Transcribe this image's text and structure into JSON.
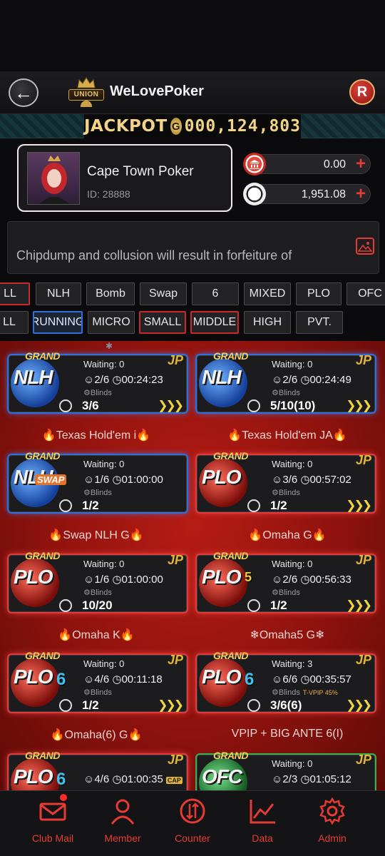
{
  "header": {
    "club_name": "WeLovePoker",
    "union_label": "UNION",
    "r_button": "R"
  },
  "jackpot": {
    "label": "JACKPOT",
    "coin": "G",
    "value": "000,124,803"
  },
  "profile": {
    "name": "Cape Town Poker",
    "id": "ID: 28888"
  },
  "balances": [
    {
      "icon": "bank-icon",
      "amount": "0.00",
      "plus": "+"
    },
    {
      "icon": "chip-icon",
      "amount": "1,951.08",
      "plus": "+"
    }
  ],
  "notice": {
    "text": "Chipdump and collusion will result in forfeiture of"
  },
  "game_filters": [
    "LL",
    "NLH",
    "Bomb",
    "Swap",
    "6",
    "MIXED",
    "PLO",
    "OFC"
  ],
  "stake_filters": [
    "LL",
    "RUNNING",
    "MICRO",
    "SMALL",
    "MIDDLE",
    "HIGH",
    "PVT."
  ],
  "tables": [
    {
      "logo": "NLH",
      "grand": "GRAND",
      "waiting": "Waiting: 0",
      "players": "2/6",
      "time": "00:24:23",
      "blinds": "Blinds",
      "stake": "3/6",
      "title": "Texas Hold'em i",
      "jp": "JP"
    },
    {
      "logo": "NLH",
      "grand": "GRAND",
      "waiting": "Waiting: 0",
      "players": "2/6",
      "time": "00:24:49",
      "blinds": "Blinds",
      "stake": "5/10",
      "stake_extra": "(10)",
      "title": "Texas Hold'em JA",
      "jp": "JP"
    },
    {
      "logo": "NLH",
      "grand": "GRAND",
      "swap": "SWAP",
      "waiting": "Waiting: 0",
      "players": "1/6",
      "time": "01:00:00",
      "blinds": "Blinds",
      "stake": "1/2",
      "title": "Swap NLH  G",
      "jp": ""
    },
    {
      "logo": "PLO",
      "grand": "GRAND",
      "waiting": "Waiting: 0",
      "players": "3/6",
      "time": "00:57:02",
      "blinds": "Blinds",
      "stake": "1/2",
      "title": "Omaha G",
      "jp": "JP"
    },
    {
      "logo": "PLO",
      "grand": "GRAND",
      "waiting": "Waiting: 0",
      "players": "1/6",
      "time": "01:00:00",
      "blinds": "Blinds",
      "stake": "10/20",
      "title": "Omaha K",
      "jp": "JP"
    },
    {
      "logo": "PLO",
      "grand": "GRAND",
      "sub": "5",
      "waiting": "Waiting: 0",
      "players": "2/6",
      "time": "00:56:33",
      "blinds": "Blinds",
      "stake": "1/2",
      "title": "Omaha5 G",
      "jp": "JP"
    },
    {
      "logo": "PLO",
      "grand": "GRAND",
      "sub": "6",
      "waiting": "Waiting: 0",
      "players": "4/6",
      "time": "00:11:18",
      "blinds": "Blinds",
      "stake": "1/2",
      "title": "Omaha(6)  G",
      "jp": "JP"
    },
    {
      "logo": "PLO",
      "grand": "GRAND",
      "sub": "6",
      "waiting": "Waiting: 3",
      "players": "6/6",
      "time": "00:35:57",
      "blinds": "Blinds",
      "vpip": "T-VPIP 45%",
      "stake": "3/6",
      "stake_extra": "(6)",
      "title": "VPIP + BIG ANTE 6(I)",
      "jp": "JP"
    },
    {
      "logo": "PLO",
      "grand": "GRAND",
      "sub": "6",
      "waiting": "",
      "players": "4/6",
      "time": "01:00:35",
      "cap": "CAP",
      "jp": "JP"
    },
    {
      "logo": "OFC",
      "grand": "GRAND",
      "waiting": "Waiting: 0",
      "players": "2/3",
      "time": "01:05:12",
      "jp": "JP"
    }
  ],
  "nav": [
    {
      "label": "Club Mail",
      "icon": "mail-icon"
    },
    {
      "label": "Member",
      "icon": "member-icon"
    },
    {
      "label": "Counter",
      "icon": "counter-icon"
    },
    {
      "label": "Data",
      "icon": "chart-icon"
    },
    {
      "label": "Admin",
      "icon": "gear-icon"
    }
  ]
}
